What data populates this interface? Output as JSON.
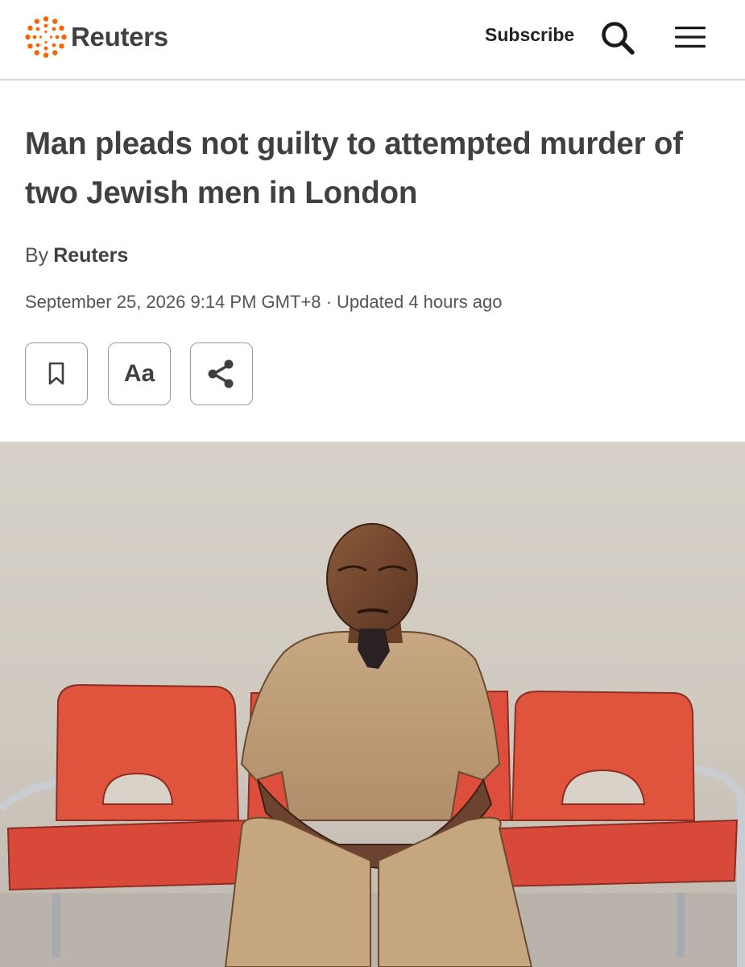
{
  "header": {
    "brand_name": "Reuters",
    "subscribe_label": "Subscribe",
    "search_icon": "search-icon",
    "menu_icon": "hamburger-menu-icon",
    "brand_color": "#fa6400"
  },
  "article": {
    "headline": "Man pleads not guilty to attempted murder of two Jewish men in London",
    "byline_prefix": "By",
    "byline_author": "Reuters",
    "dateline": "September 25, 2026 9:14 PM GMT+8 · Updated 4 hours ago"
  },
  "tools": {
    "bookmark_icon": "bookmark-icon",
    "text_size_label": "Aa",
    "share_icon": "share-icon"
  },
  "hero_image": {
    "kind": "court sketch of a seated man on red chairs"
  }
}
